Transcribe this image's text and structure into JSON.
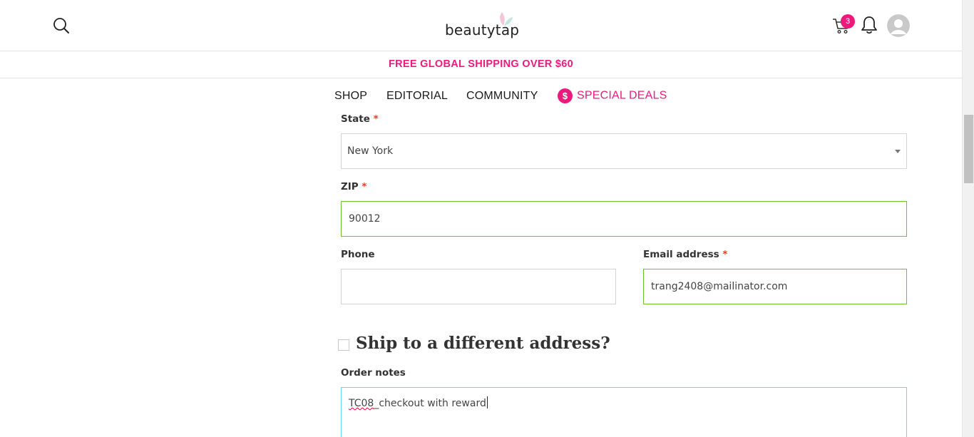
{
  "header": {
    "logo_text": "beautytap",
    "cart_count": "3",
    "brand_color": "#ec1a7d"
  },
  "promo": {
    "text": "FREE GLOBAL SHIPPING OVER $60"
  },
  "nav": {
    "shop": "SHOP",
    "editorial": "EDITORIAL",
    "community": "COMMUNITY",
    "deals_icon": "$",
    "deals": "SPECIAL DEALS"
  },
  "form": {
    "state": {
      "label": "State",
      "required": "*",
      "value": "New York"
    },
    "zip": {
      "label": "ZIP",
      "required": "*",
      "value": "90012"
    },
    "phone": {
      "label": "Phone",
      "value": ""
    },
    "email": {
      "label": "Email address",
      "required": "*",
      "value": "trang2408@mailinator.com"
    },
    "ship_different": {
      "label": "Ship to a different address?",
      "checked": false
    },
    "notes": {
      "label": "Order notes",
      "value_prefix": "TC08",
      "value_rest": "_checkout with reward"
    }
  },
  "icons": [
    "search-icon",
    "cart-icon",
    "bell-icon",
    "avatar-icon",
    "dollar-icon",
    "chevron-down-icon"
  ]
}
